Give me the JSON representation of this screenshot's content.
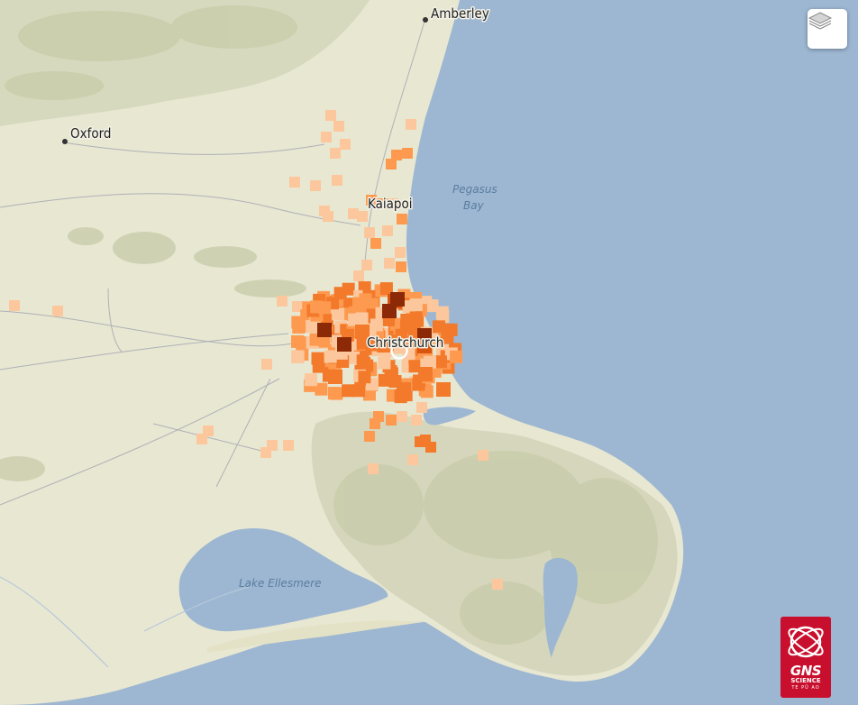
{
  "places": {
    "amberley": "Amberley",
    "oxford": "Oxford",
    "kaiapoi": "Kaiapoi",
    "christchurch": "Christchurch"
  },
  "water": {
    "pegasus_bay_line1": "Pegasus",
    "pegasus_bay_line2": "Bay",
    "lake_ellesmere": "Lake Ellesmere"
  },
  "controls": {
    "layers_icon": "layers-icon"
  },
  "logo": {
    "line1": "GNS",
    "line2": "SCIENCE",
    "line3": "TE PŪ AO"
  },
  "colors": {
    "sea": "#9db7d2",
    "land": "#e8e7d2",
    "hills": "#cfd2b4",
    "intensity_light": "#fcc79c",
    "intensity_medium": "#fd9a50",
    "intensity_strong": "#f37a2a",
    "intensity_severe": "#d95510",
    "intensity_extreme": "#8c2a07",
    "epicentre": "#ffffff",
    "logo_red": "#c8102e"
  }
}
